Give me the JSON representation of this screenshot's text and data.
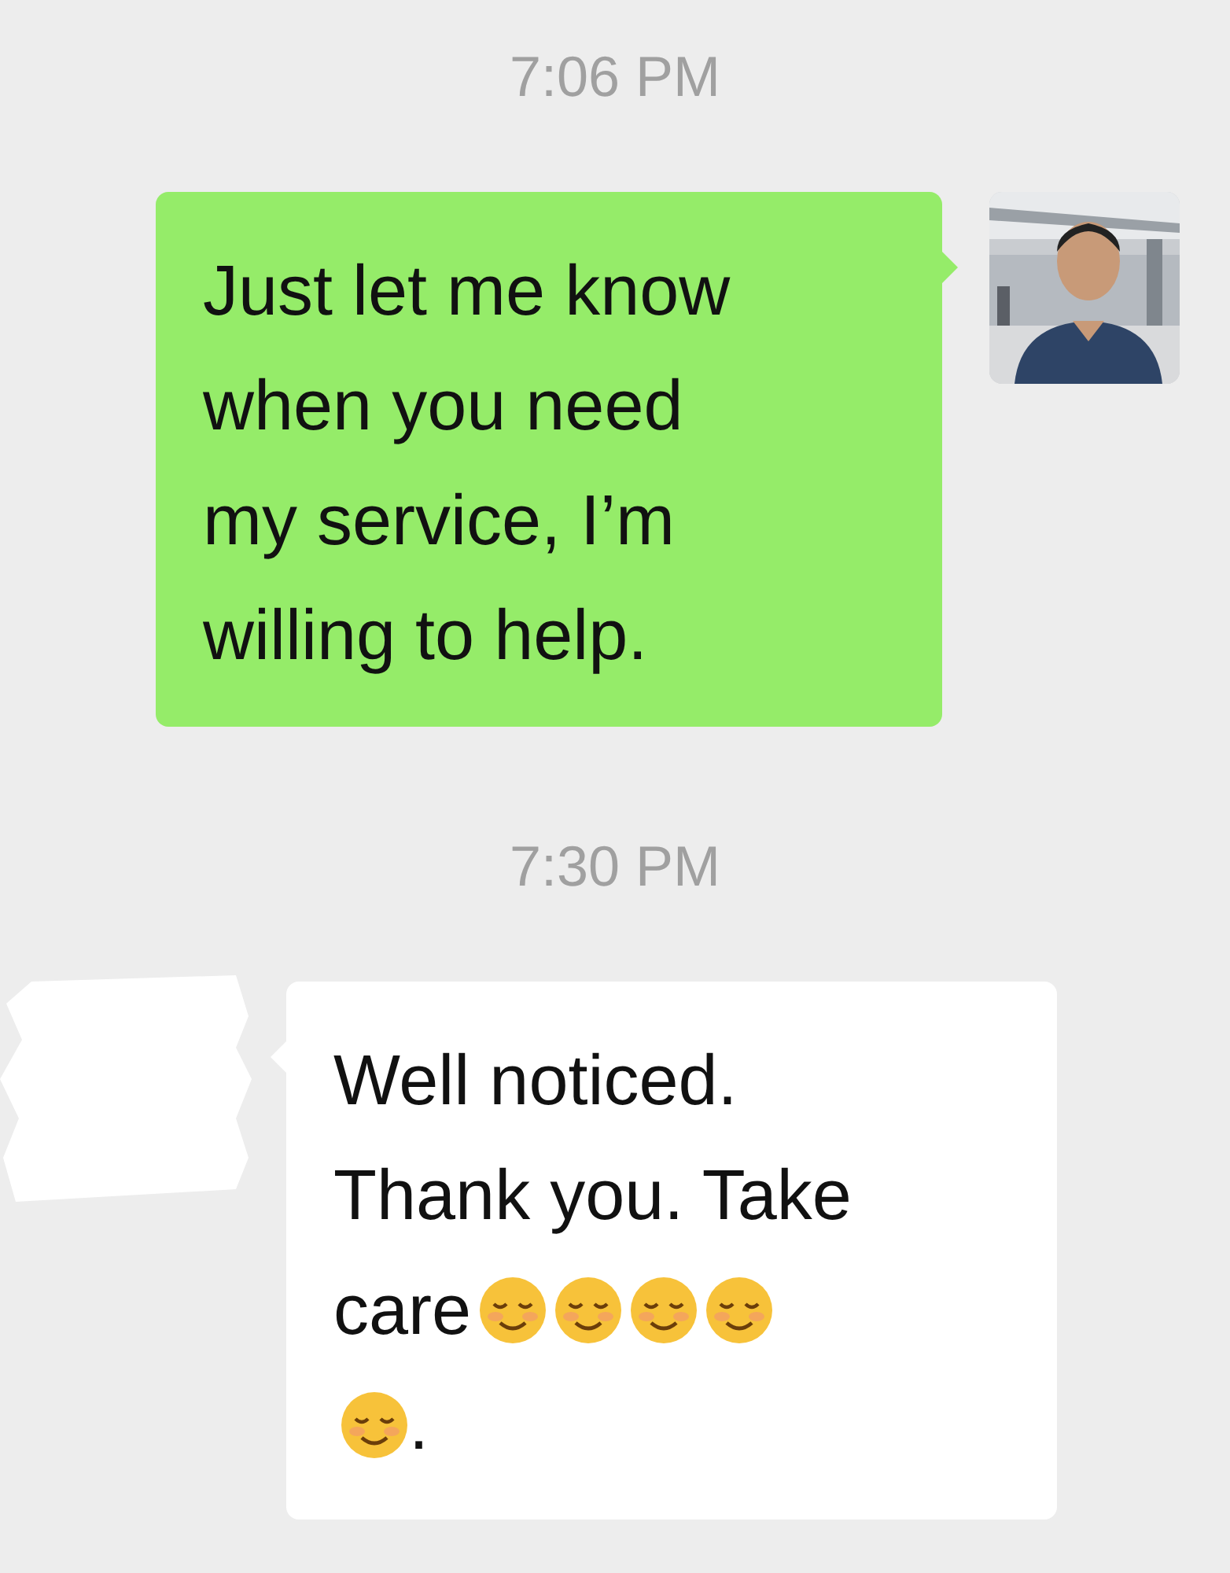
{
  "messages": [
    {
      "kind": "timestamp",
      "text": "7:06 PM"
    },
    {
      "kind": "outgoing",
      "avatar": {
        "kind": "picture"
      },
      "lines": [
        [
          {
            "kind": "text",
            "text": "Just let me know"
          }
        ],
        [
          {
            "kind": "text",
            "text": "when you need"
          }
        ],
        [
          {
            "kind": "text",
            "text": "my service, I’m"
          }
        ],
        [
          {
            "kind": "text",
            "text": "willing to help."
          }
        ]
      ]
    },
    {
      "kind": "timestamp",
      "text": "7:30 PM"
    },
    {
      "kind": "incoming",
      "avatar": {
        "kind": "redacted"
      },
      "lines": [
        [
          {
            "kind": "text",
            "text": "Well noticed."
          }
        ],
        [
          {
            "kind": "text",
            "text": "Thank you. Take"
          }
        ],
        [
          {
            "kind": "text",
            "text": "care"
          },
          {
            "kind": "emoji"
          },
          {
            "kind": "emoji"
          },
          {
            "kind": "emoji"
          },
          {
            "kind": "emoji"
          }
        ],
        [
          {
            "kind": "emoji"
          },
          {
            "kind": "text",
            "text": "."
          }
        ]
      ]
    }
  ]
}
